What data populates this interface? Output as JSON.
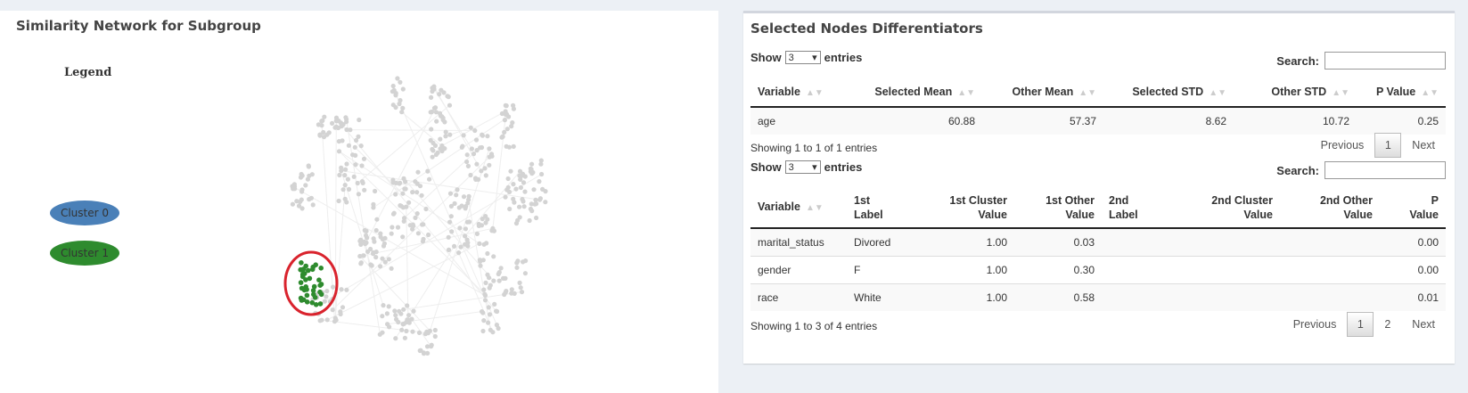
{
  "left_panel": {
    "title": "Similarity Network for Subgroup",
    "legend": {
      "title": "Legend",
      "items": [
        {
          "label": "Cluster 0",
          "color": "#4a80b8"
        },
        {
          "label": "Cluster 1",
          "color": "#2e8b2e"
        }
      ]
    },
    "node_color_default": "#d3d3d3",
    "node_color_selected": "#2e8b2e",
    "selection_ring_color": "#d9232d"
  },
  "right_panel": {
    "title": "Selected Nodes Differentiators",
    "table1": {
      "show_label": "Show",
      "entries_label": "entries",
      "page_length": "3",
      "search_label": "Search:",
      "columns": [
        "Variable",
        "Selected Mean",
        "Other Mean",
        "Selected STD",
        "Other STD",
        "P Value"
      ],
      "rows": [
        [
          "age",
          "60.88",
          "57.37",
          "8.62",
          "10.72",
          "0.25"
        ]
      ],
      "info": "Showing 1 to 1 of 1 entries",
      "pager": {
        "previous": "Previous",
        "pages": [
          "1"
        ],
        "next": "Next"
      }
    },
    "table2": {
      "show_label": "Show",
      "entries_label": "entries",
      "page_length": "3",
      "search_label": "Search:",
      "columns": [
        [
          "Variable"
        ],
        [
          "1st",
          "Label"
        ],
        [
          "1st Cluster",
          "Value"
        ],
        [
          "1st Other",
          "Value"
        ],
        [
          "2nd",
          "Label"
        ],
        [
          "2nd Cluster",
          "Value"
        ],
        [
          "2nd Other",
          "Value"
        ],
        [
          "P",
          "Value"
        ]
      ],
      "rows": [
        [
          "marital_status",
          "Divored",
          "1.00",
          "0.03",
          "",
          "",
          "",
          "0.00"
        ],
        [
          "gender",
          "F",
          "1.00",
          "0.30",
          "",
          "",
          "",
          "0.00"
        ],
        [
          "race",
          "White",
          "1.00",
          "0.58",
          "",
          "",
          "",
          "0.01"
        ]
      ],
      "info": "Showing 1 to 3 of 4 entries",
      "pager": {
        "previous": "Previous",
        "pages": [
          "1",
          "2"
        ],
        "next": "Next"
      }
    }
  }
}
